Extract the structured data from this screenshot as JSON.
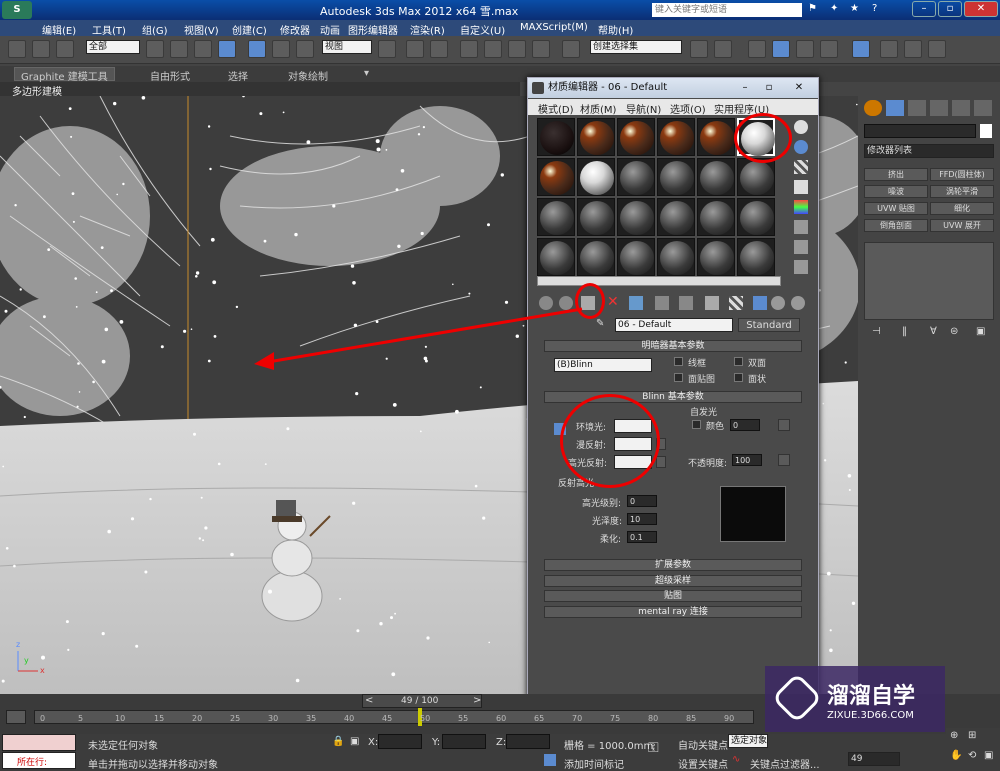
{
  "window": {
    "title": "Autodesk 3ds Max  2012 x64     雪.max",
    "search_placeholder": "键入关键字或短语"
  },
  "menubar": [
    "编辑(E)",
    "工具(T)",
    "组(G)",
    "视图(V)",
    "创建(C)",
    "修改器",
    "动画",
    "图形编辑器",
    "渲染(R)",
    "自定义(U)",
    "MAXScript(M)",
    "帮助(H)"
  ],
  "toolbar": {
    "selection_filter": "全部",
    "ref_coord": "视图",
    "named_selection": "创建选择集"
  },
  "ribbon": {
    "tabs": [
      "Graphite 建模工具",
      "自由形式",
      "选择",
      "对象绘制"
    ],
    "subtab": "多边形建模"
  },
  "viewport": {
    "axes": {
      "x": "x",
      "y": "y",
      "z": "z"
    }
  },
  "material_editor": {
    "title": "材质编辑器 - 06 - Default",
    "menu": [
      "模式(D)",
      "材质(M)",
      "导航(N)",
      "选项(O)",
      "实用程序(U)"
    ],
    "material_name": "06 - Default",
    "material_type": "Standard",
    "shader_rollout": "明暗器基本参数",
    "shader": "(B)Blinn",
    "shader_options": [
      "线框",
      "双面",
      "面贴图",
      "面状"
    ],
    "blinn_rollout": "Blinn 基本参数",
    "self_illum": "自发光",
    "color_label": "颜色",
    "color_value": "0",
    "ambient": "环境光:",
    "diffuse": "漫反射:",
    "specular": "高光反射:",
    "opacity_label": "不透明度:",
    "opacity": "100",
    "spec_group": "反射高光",
    "spec_level_label": "高光级别:",
    "spec_level": "0",
    "glossiness_label": "光泽度:",
    "glossiness": "10",
    "soften_label": "柔化:",
    "soften": "0.1",
    "rollouts": [
      "扩展参数",
      "超级采样",
      "贴图",
      "mental ray 连接"
    ]
  },
  "command_panel": {
    "modifier_list": "修改器列表",
    "buttons": [
      "挤出",
      "FFD(圆柱体)",
      "噪波",
      "涡轮平滑",
      "UVW 贴图",
      "细化",
      "倒角剖面",
      "UVW 展开"
    ]
  },
  "timeline": {
    "frame": "49 / 100",
    "ticks": [
      "0",
      "5",
      "10",
      "15",
      "20",
      "25",
      "30",
      "35",
      "40",
      "45",
      "50",
      "55",
      "60",
      "65",
      "70",
      "75",
      "80",
      "85",
      "90"
    ]
  },
  "status": {
    "mode": "所在行:",
    "selection": "未选定任何对象",
    "prompt": "单击并拖动以选择并移动对象",
    "x_label": "X:",
    "y_label": "Y:",
    "z_label": "Z:",
    "grid": "栅格 = 1000.0mm",
    "autokey": "自动关键点",
    "selected": "选定对象",
    "setkey": "设置关键点",
    "keyfilter": "关键点过滤器...",
    "add_time_tag": "添加时间标记",
    "frame_field": "49"
  },
  "watermark": {
    "brand": "溜溜自学",
    "url": "ZIXUE.3D66.COM"
  },
  "colors": {
    "annotation": "#e00000",
    "title_blue": "#0b3e8e"
  }
}
